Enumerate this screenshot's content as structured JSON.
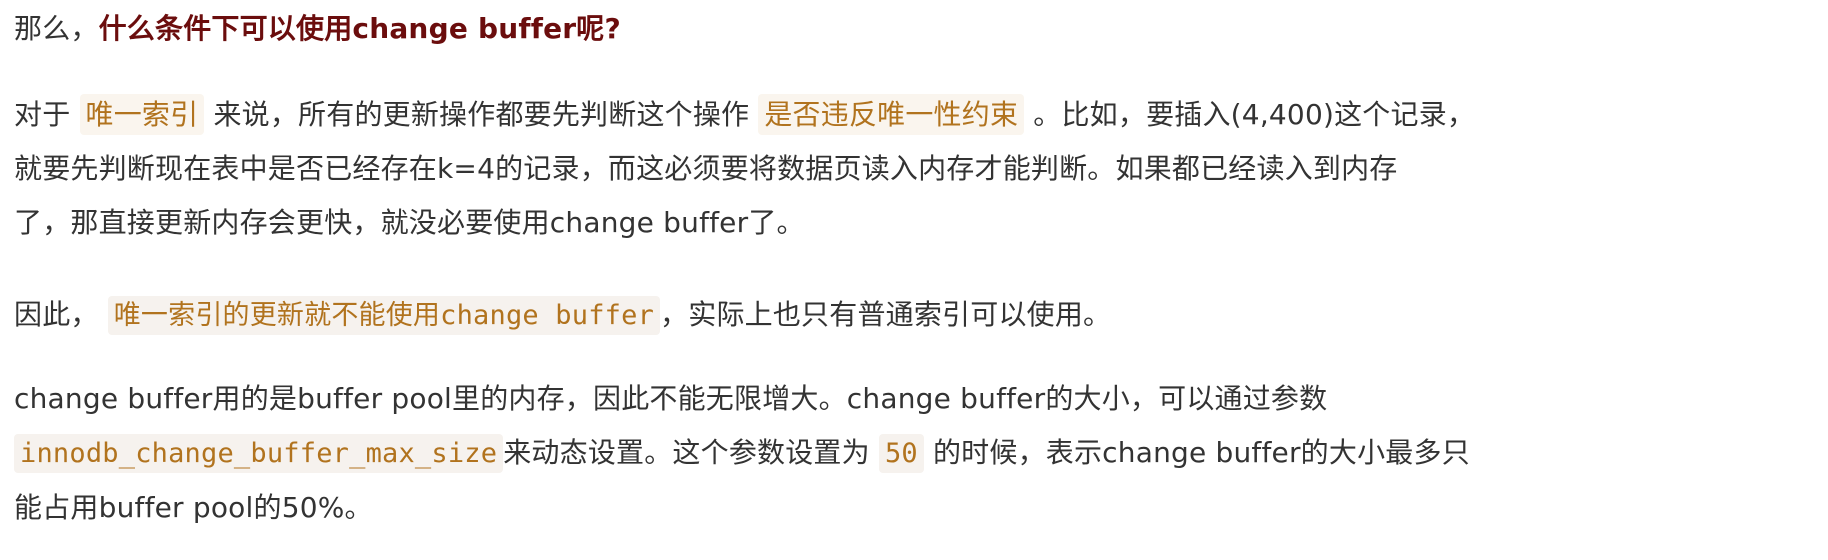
{
  "p1": {
    "lead": "那么，",
    "bold": "什么条件下可以使用change buffer呢?"
  },
  "p2": {
    "l1_a": "对于",
    "l1_hl1": "唯一索引",
    "l1_b": "来说，所有的更新操作都要先判断这个操作",
    "l1_hl2": "是否违反唯一性约束",
    "l1_c": "。比如，要插入(4,400)这个记录，",
    "l2": "就要先判断现在表中是否已经存在k=4的记录，而这必须要将数据页读入内存才能判断。如果都已经读入到内存",
    "l3": "了，那直接更新内存会更快，就没必要使用change buffer了。"
  },
  "p3": {
    "a": "因此，",
    "hl": "唯一索引的更新就不能使用change buffer",
    "b": "，实际上也只有普通索引可以使用。"
  },
  "p4": {
    "l1": "change buffer用的是buffer pool里的内存，因此不能无限增大。change buffer的大小，可以通过参数",
    "l2_code1": "innodb_change_buffer_max_size",
    "l2_a": "来动态设置。这个参数设置为",
    "l2_code2": "50",
    "l2_b": "的时候，表示change buffer的大小最多只",
    "l3": "能占用buffer pool的50%。"
  },
  "colors": {
    "text": "#333333",
    "bold_heading": "#6b0d0d",
    "highlight_text": "#b1731e",
    "highlight_bg": "#faf5ee"
  }
}
